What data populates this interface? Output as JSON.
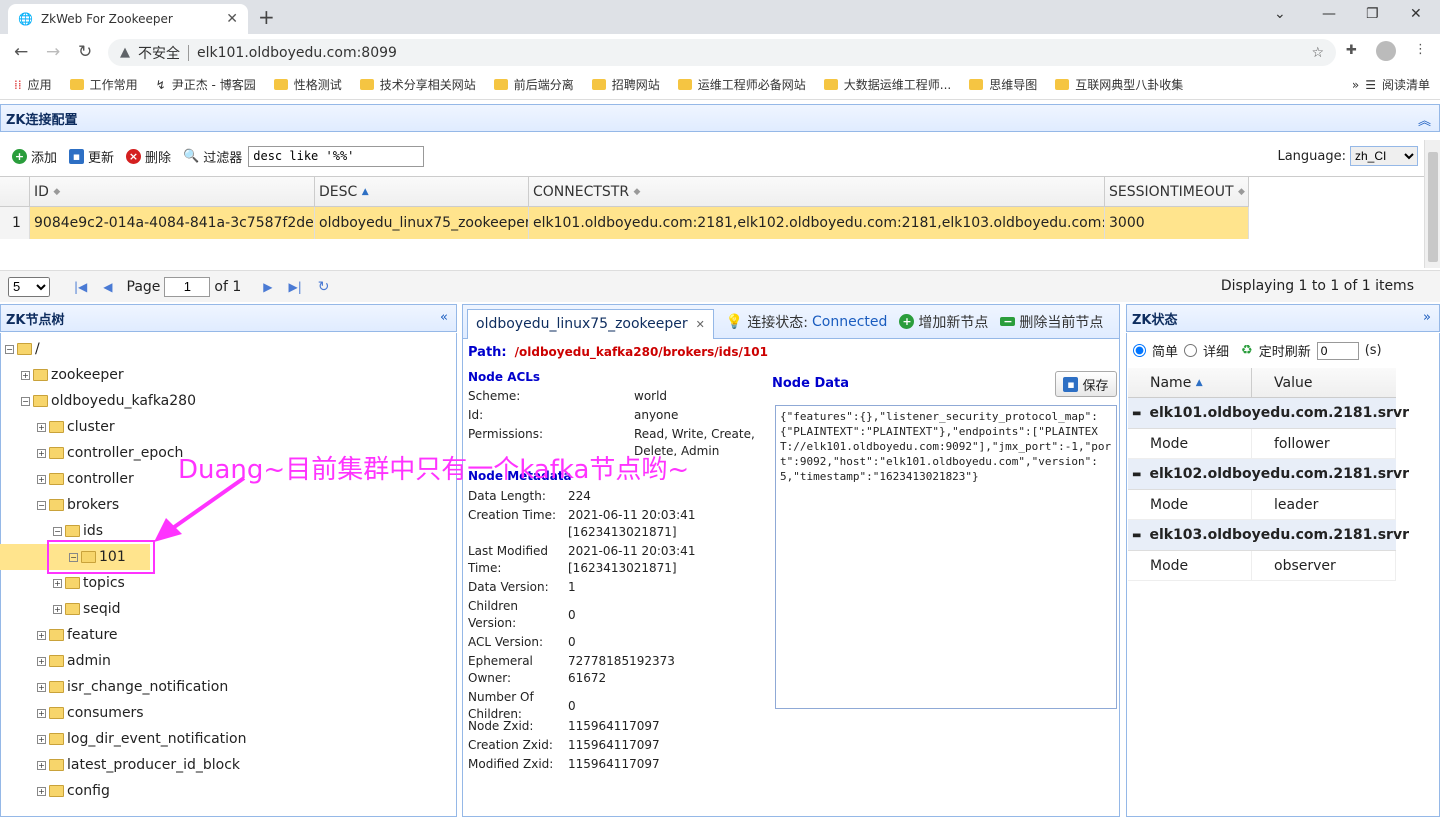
{
  "browser": {
    "tab_title": "ZkWeb For Zookeeper",
    "insecure_label": "不安全",
    "url": "elk101.oldboyedu.com:8099",
    "bookmarks": [
      "应用",
      "工作常用",
      "尹正杰 - 博客园",
      "性格测试",
      "技术分享相关网站",
      "前后端分离",
      "招聘网站",
      "运维工程师必备网站",
      "大数据运维工程师...",
      "思维导图",
      "互联网典型八卦收集"
    ],
    "reading_list": "阅读清单"
  },
  "zkconf": {
    "title": "ZK连接配置",
    "add": "添加",
    "update": "更新",
    "delete": "删除",
    "filter": "过滤器",
    "filter_value": "desc like '%%'",
    "language_label": "Language:",
    "language_value": "zh_CI",
    "columns": [
      "ID",
      "DESC",
      "CONNECTSTR",
      "SESSIONTIMEOUT"
    ],
    "row": {
      "num": "1",
      "id": "9084e9c2-014a-4084-841a-3c7587f2decb",
      "desc": "oldboyedu_linux75_zookeeper",
      "connect": "elk101.oldboyedu.com:2181,elk102.oldboyedu.com:2181,elk103.oldboyedu.com:2181",
      "timeout": "3000"
    }
  },
  "pager": {
    "size": "5",
    "page_label": "Page",
    "page": "1",
    "of": "of 1",
    "displaying": "Displaying 1 to 1 of 1 items"
  },
  "tree": {
    "title": "ZK节点树",
    "nodes": [
      "/",
      "zookeeper",
      "oldboyedu_kafka280",
      "cluster",
      "controller_epoch",
      "controller",
      "brokers",
      "ids",
      "101",
      "topics",
      "seqid",
      "feature",
      "admin",
      "isr_change_notification",
      "consumers",
      "log_dir_event_notification",
      "latest_producer_id_block",
      "config"
    ]
  },
  "annotation": "Duang~目前集群中只有一个kafka节点哟~",
  "center": {
    "tab": "oldboyedu_linux75_zookeeper",
    "conn_label": "连接状态:",
    "conn_value": "Connected",
    "add_node": "增加新节点",
    "del_node": "删除当前节点",
    "path_label": "Path:",
    "path_value": "/oldboyedu_kafka280/brokers/ids/101",
    "acl_title": "Node ACLs",
    "acls": [
      [
        "Scheme:",
        "world"
      ],
      [
        "Id:",
        "anyone"
      ],
      [
        "Permissions:",
        "Read, Write, Create, Delete, Admin"
      ]
    ],
    "meta_title": "Node Metadata",
    "meta": [
      [
        "Data Length:",
        "224"
      ],
      [
        "Creation Time:",
        "2021-06-11 20:03:41 [1623413021871]"
      ],
      [
        "Last Modified Time:",
        "2021-06-11 20:03:41 [1623413021871]"
      ],
      [
        "Data Version:",
        "1"
      ],
      [
        "Children Version:",
        "0"
      ],
      [
        "ACL Version:",
        "0"
      ],
      [
        "Ephemeral Owner:",
        "72778185192373 61672"
      ],
      [
        "Number Of Children:",
        "0"
      ],
      [
        "Node Zxid:",
        "115964117097"
      ],
      [
        "Creation Zxid:",
        "115964117097"
      ],
      [
        "Modified Zxid:",
        "115964117097"
      ]
    ],
    "data_title": "Node Data",
    "save": "保存",
    "data": "{\"features\":{},\"listener_security_protocol_map\":{\"PLAINTEXT\":\"PLAINTEXT\"},\"endpoints\":[\"PLAINTEXT://elk101.oldboyedu.com:9092\"],\"jmx_port\":-1,\"port\":9092,\"host\":\"elk101.oldboyedu.com\",\"version\":5,\"timestamp\":\"1623413021823\"}"
  },
  "status": {
    "title": "ZK状态",
    "simple": "简单",
    "detail": "详细",
    "refresh": "定时刷新",
    "interval": "0",
    "unit": "(s)",
    "col_name": "Name",
    "col_value": "Value",
    "groups": [
      {
        "server": "elk101.oldboyedu.com.2181.srvr",
        "key": "Mode",
        "value": "follower"
      },
      {
        "server": "elk102.oldboyedu.com.2181.srvr",
        "key": "Mode",
        "value": "leader"
      },
      {
        "server": "elk103.oldboyedu.com.2181.srvr",
        "key": "Mode",
        "value": "observer"
      }
    ]
  }
}
